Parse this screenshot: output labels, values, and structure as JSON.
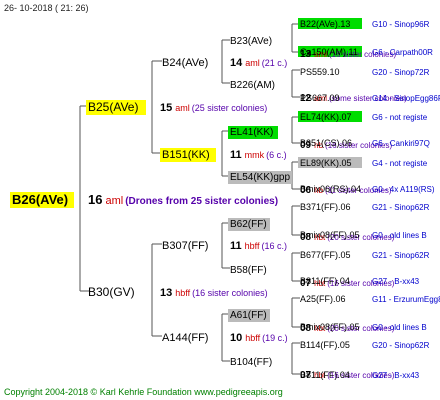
{
  "header": {
    "date": "26- 10-2018 ( 21: 26)"
  },
  "footer": {
    "copyright": "Copyright 2004-2018 © Karl Kehrle Foundation   www.pedigreeapis.org"
  },
  "colors": {
    "yellow": "#ffff00",
    "green": "#00dd00",
    "grey": "#bbbbbb",
    "red": "#cc0000",
    "purple": "#5500aa",
    "blue": "#0000cc",
    "line": "#555555"
  },
  "root": {
    "name": "B26(AVe)",
    "number": "16",
    "code": "aml",
    "note": "(Drones from 25 sister colonies)"
  },
  "gen1": {
    "top": {
      "name": "B25(AVe)",
      "number": "15",
      "code": "aml",
      "note": "(25 sister colonies)"
    },
    "bottom": {
      "name": "B30(GV)",
      "number": "13",
      "code": "hbff",
      "note": "(16 sister colonies)"
    }
  },
  "gen2": {
    "a": {
      "name": "B24(AVe)",
      "number": "14",
      "code": "aml",
      "note": "(21 c.)"
    },
    "b": {
      "name": "B151(KK)",
      "number": "11",
      "code": "mmk",
      "note": "(6 c.)"
    },
    "c": {
      "name": "B307(FF)",
      "number": "11",
      "code": "hbff",
      "note": "(16 c.)"
    },
    "d": {
      "name": "A144(FF)",
      "number": "10",
      "code": "hbff",
      "note": "(19 c.)"
    }
  },
  "gen3": {
    "a": {
      "name": "B23(AVe)",
      "number": "13",
      "code": "aml",
      "note": "(16 sister colonies)"
    },
    "b": {
      "name": "B226(AM)",
      "number": "12",
      "code": "aml",
      "note": "(some sister colonies)"
    },
    "c": {
      "name": "EL41(KK)",
      "number": "09",
      "code": "hb",
      "note": "(16 sister colonies)"
    },
    "d": {
      "name": "EL54(KK)gpp",
      "number": "06",
      "code": "hb",
      "note": "(11 sister colonies)"
    },
    "e": {
      "name": "B62(FF)",
      "number": "08",
      "code": "hbt",
      "note": "(20 sister colonies)"
    },
    "f": {
      "name": "B58(FF)",
      "number": "07",
      "code": "hbt",
      "note": "(16 sister colonies)"
    },
    "g": {
      "name": "A61(FF)",
      "number": "08",
      "code": "hbt",
      "note": "(20 sister colonies)"
    },
    "h": {
      "name": "B104(FF)",
      "number": "07",
      "code": "hbt",
      "note": "(16 sister colonies)"
    }
  },
  "gen4": [
    {
      "name": "B22(AVe).13",
      "id": "G10 - Sinop96R"
    },
    {
      "name": "Ca150(AM).11",
      "id": "G6 - Carpath00R"
    },
    {
      "name": "PS559.10",
      "id": "G20 - Sinop72R"
    },
    {
      "name": "PS667.09",
      "id": "G14 - SinopEgg86R"
    },
    {
      "name": "EL74(KK).07",
      "id": "G6 - not registe"
    },
    {
      "name": "B351(CS).06",
      "id": "G6 - Cankiri97Q"
    },
    {
      "name": "EL89(KK).05",
      "id": "G4 - not registe"
    },
    {
      "name": "Bmix06(RS).04",
      "id": "G0 - 4x A119(RS)"
    },
    {
      "name": "B371(FF).06",
      "id": "G21 - Sinop62R"
    },
    {
      "name": "Bmix08(FF).05",
      "id": "G0 - old lines B"
    },
    {
      "name": "B677(FF).05",
      "id": "G21 - Sinop62R"
    },
    {
      "name": "B811(FF).04",
      "id": "G27 - B-xx43"
    },
    {
      "name": "A25(FF).06",
      "id": "G11 - ErzurumEgg8"
    },
    {
      "name": "Bmix08(FF).05",
      "id": "G0 - old lines B"
    },
    {
      "name": "B114(FF).05",
      "id": "G20 - Sinop62R"
    },
    {
      "name": "B811(FF).04",
      "id": "G27 - B-xx43"
    }
  ]
}
